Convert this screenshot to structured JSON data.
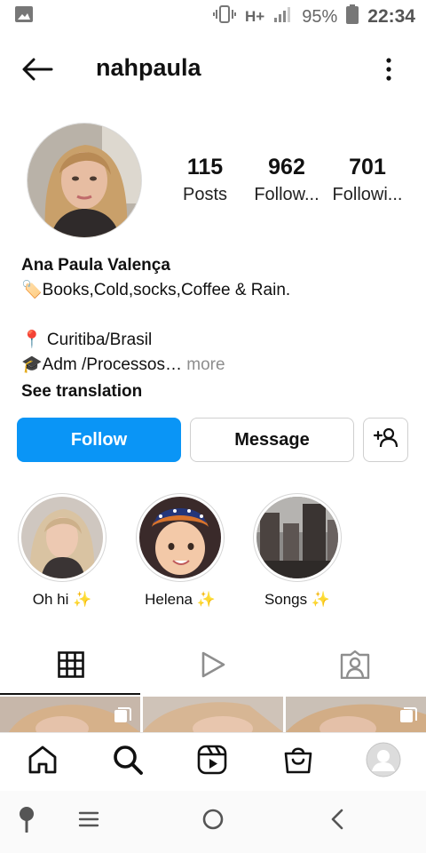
{
  "status_bar": {
    "battery": "95%",
    "time": "22:34",
    "network": "H+"
  },
  "header": {
    "username": "nahpaula"
  },
  "profile": {
    "stats": [
      {
        "value": "115",
        "label": "Posts"
      },
      {
        "value": "962",
        "label": "Follow..."
      },
      {
        "value": "701",
        "label": "Followi..."
      }
    ],
    "name": "Ana Paula Valença",
    "bio_line1": "🏷️Books,Cold,socks,Coffee & Rain.",
    "bio_line2": "📍 Curitiba/Brasil",
    "bio_line3": "🎓Adm /Processos…",
    "more": "more",
    "see_translation": "See translation"
  },
  "buttons": {
    "follow": "Follow",
    "message": "Message"
  },
  "highlights": [
    {
      "label": "Oh hi",
      "icon": "sparkles-icon"
    },
    {
      "label": "Helena",
      "icon": "sparkles-icon"
    },
    {
      "label": "Songs",
      "icon": "sparkles-icon"
    }
  ],
  "tabs": [
    "grid-icon",
    "reels-icon",
    "tagged-icon"
  ],
  "bottom_nav": [
    "home-icon",
    "search-icon",
    "reels-icon",
    "shop-icon",
    "profile-avatar"
  ],
  "colors": {
    "primary": "#0a95f6",
    "text": "#111111",
    "muted": "#8e8e8e"
  }
}
